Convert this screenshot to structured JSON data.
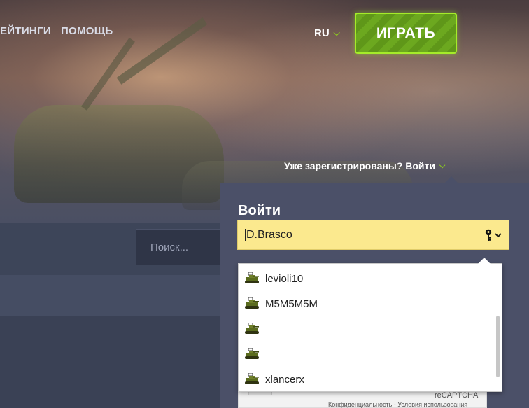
{
  "nav": {
    "items": [
      "ЕЙТИНГИ",
      "ПОМОЩЬ"
    ]
  },
  "lang": {
    "label": "RU"
  },
  "play_button": {
    "label": "ИГРАТЬ"
  },
  "auth": {
    "registered_link": "Уже зарегистрированы? Войти"
  },
  "search": {
    "placeholder": "Поиск..."
  },
  "login": {
    "title": "Войти",
    "username_value": "D.Brasco"
  },
  "autocomplete": {
    "items": [
      {
        "label": "levioli10"
      },
      {
        "label": "M5M5M5M"
      },
      {
        "label": ""
      },
      {
        "label": ""
      },
      {
        "label": "xlancerx"
      }
    ]
  },
  "recaptcha": {
    "title": "reCAPTCHA",
    "links": "Конфиденциальность - Условия использования"
  },
  "colors": {
    "accent_green": "#8fd11c",
    "play_green": "#6ca81f",
    "input_yellow": "#fbe98e",
    "panel_bg": "#4b5068"
  },
  "icons": [
    "chevron-down-icon",
    "key-icon",
    "tank-icon"
  ]
}
